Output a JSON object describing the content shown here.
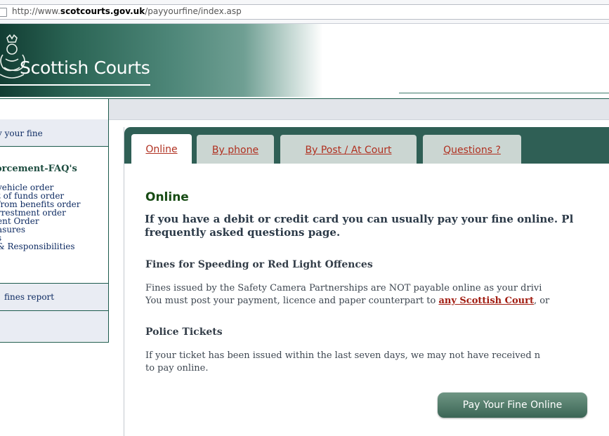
{
  "browser": {
    "url_prefix": "http://www.",
    "url_domain": "scotcourts.gov.uk",
    "url_path": "/payyourfine/index.asp"
  },
  "header": {
    "logo_text": "Scottish Courts",
    "crest_icon": "royal-crest-icon"
  },
  "sidebar": {
    "item1": "y your fine",
    "heading": "orcement-FAQ's",
    "list": [
      "vehicle order",
      "t of funds order",
      "from benefits order",
      "rrestment order",
      "ent Order",
      "asures",
      "s",
      "& Responsibilities"
    ],
    "item3": "fines report"
  },
  "tabs": [
    {
      "label": "Online"
    },
    {
      "label": "By phone"
    },
    {
      "label": "By Post / At Court"
    },
    {
      "label": "Questions ?"
    }
  ],
  "main": {
    "heading": "Online",
    "lead_line1": "If you have a debit or credit card you can usually pay your fine online. Pl",
    "lead_line2": "frequently asked questions page.",
    "section1_title": "Fines for Speeding or Red Light Offences",
    "section1_line1": "Fines issued by the Safety Camera Partnerships are NOT payable online as your drivi",
    "section1_line2_a": "You must post your payment, licence and paper counterpart to ",
    "section1_link": "any Scottish Court",
    "section1_line2_b": ", or",
    "section2_title": "Police Tickets",
    "section2_line1": "If your ticket has been issued within the last seven days, we may not have received n",
    "section2_line2": "to pay online.",
    "pay_button": "Pay Your Fine Online"
  },
  "colors": {
    "brand_green": "#2f5f55",
    "link_red": "#b03020",
    "sidebar_link": "#0f2c63"
  }
}
